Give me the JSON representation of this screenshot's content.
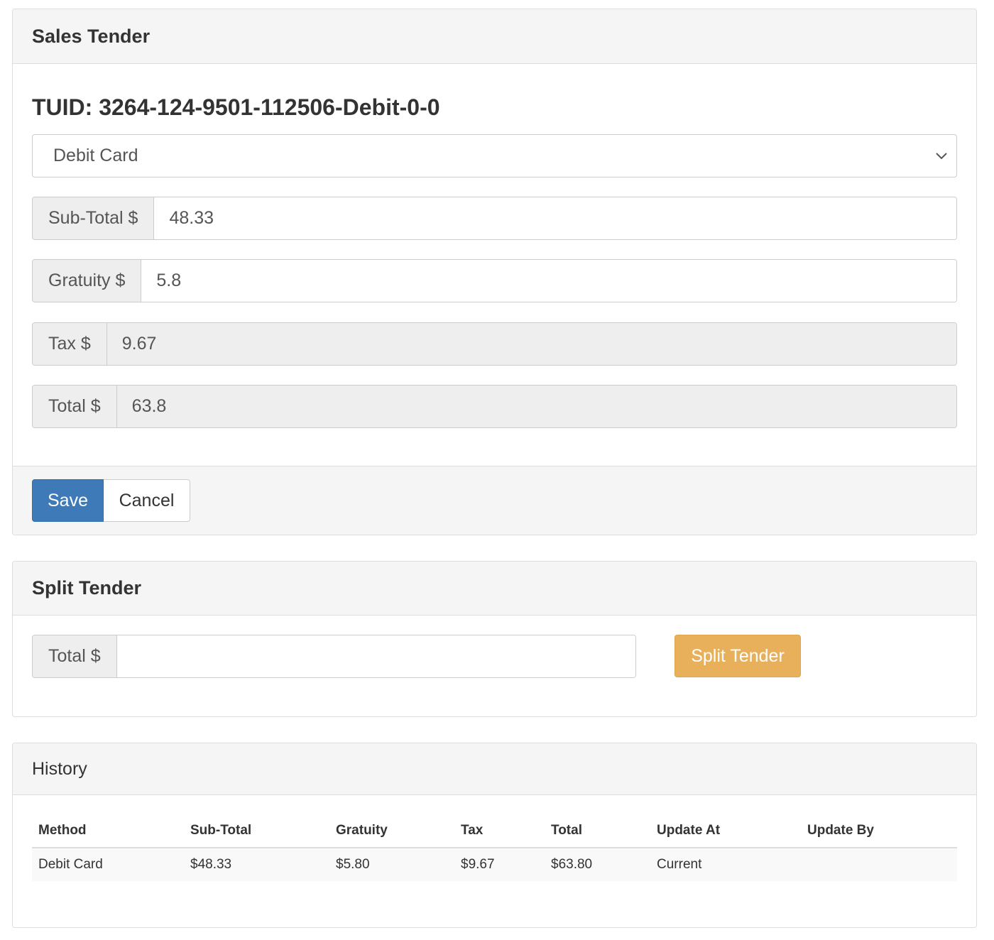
{
  "sales_tender": {
    "title": "Sales Tender",
    "tuid": "TUID: 3264-124-9501-112506-Debit-0-0",
    "method_select": {
      "selected": "Debit Card"
    },
    "subtotal": {
      "label": "Sub-Total $",
      "value": "48.33"
    },
    "gratuity": {
      "label": "Gratuity $",
      "value": "5.8"
    },
    "tax": {
      "label": "Tax $",
      "value": "9.67"
    },
    "total": {
      "label": "Total $",
      "value": "63.8"
    },
    "save_label": "Save",
    "cancel_label": "Cancel"
  },
  "split_tender": {
    "title": "Split Tender",
    "total": {
      "label": "Total $",
      "value": ""
    },
    "button_label": "Split Tender"
  },
  "history": {
    "title": "History",
    "columns": [
      "Method",
      "Sub-Total",
      "Gratuity",
      "Tax",
      "Total",
      "Update At",
      "Update By"
    ],
    "rows": [
      [
        "Debit Card",
        "$48.33",
        "$5.80",
        "$9.67",
        "$63.80",
        "Current",
        ""
      ]
    ]
  },
  "colors": {
    "primary": "#3f7ab8",
    "warning": "#e9b05b",
    "panel_heading": "#f5f5f5",
    "addon": "#eeeeee"
  },
  "icons": {
    "select_caret": "chevron-down-icon"
  }
}
